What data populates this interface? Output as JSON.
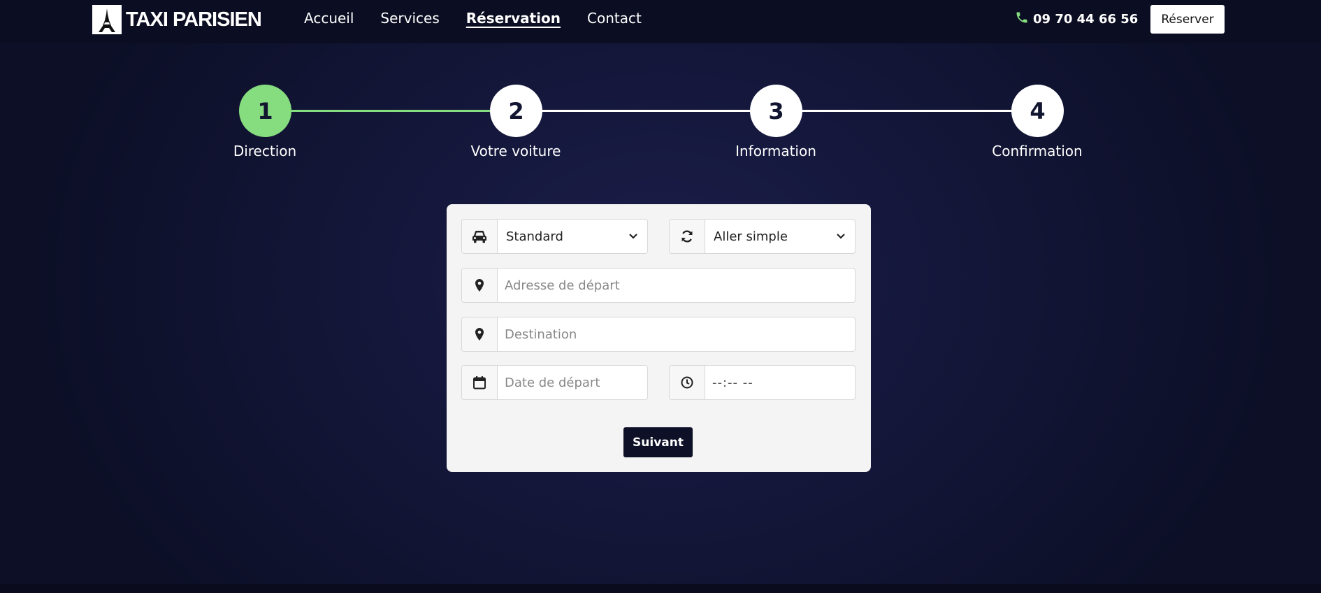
{
  "brand": {
    "name": "TAXI PARISIEN",
    "logo_icon": "eiffel-tower-icon"
  },
  "nav": {
    "links": [
      {
        "label": "Accueil"
      },
      {
        "label": "Services"
      },
      {
        "label": "Réservation"
      },
      {
        "label": "Contact"
      }
    ],
    "active_index": 2,
    "phone": "09 70 44 66 56",
    "phone_icon": "phone-icon",
    "reserve_label": "Réserver"
  },
  "stepper": {
    "steps": [
      {
        "number": "1",
        "label": "Direction"
      },
      {
        "number": "2",
        "label": "Votre voiture"
      },
      {
        "number": "3",
        "label": "Information"
      },
      {
        "number": "4",
        "label": "Confirmation"
      }
    ],
    "current_step": 1
  },
  "form": {
    "vehicle": {
      "value": "Standard",
      "icon": "car-icon"
    },
    "trip_type": {
      "value": "Aller simple",
      "icon": "sync-icon"
    },
    "departure": {
      "placeholder": "Adresse de départ",
      "icon": "map-marker-icon"
    },
    "destination": {
      "placeholder": "Destination",
      "icon": "map-marker-icon"
    },
    "date": {
      "placeholder": "Date de départ",
      "icon": "calendar-icon"
    },
    "time": {
      "placeholder": "--:-- --",
      "icon": "clock-icon"
    },
    "submit_label": "Suivant"
  },
  "colors": {
    "accent_green": "#86dd7f",
    "nav_bg": "#0b0e22",
    "page_bg": "#14173a",
    "card_bg": "#f4f4f4",
    "button_dark": "#0d1026"
  }
}
